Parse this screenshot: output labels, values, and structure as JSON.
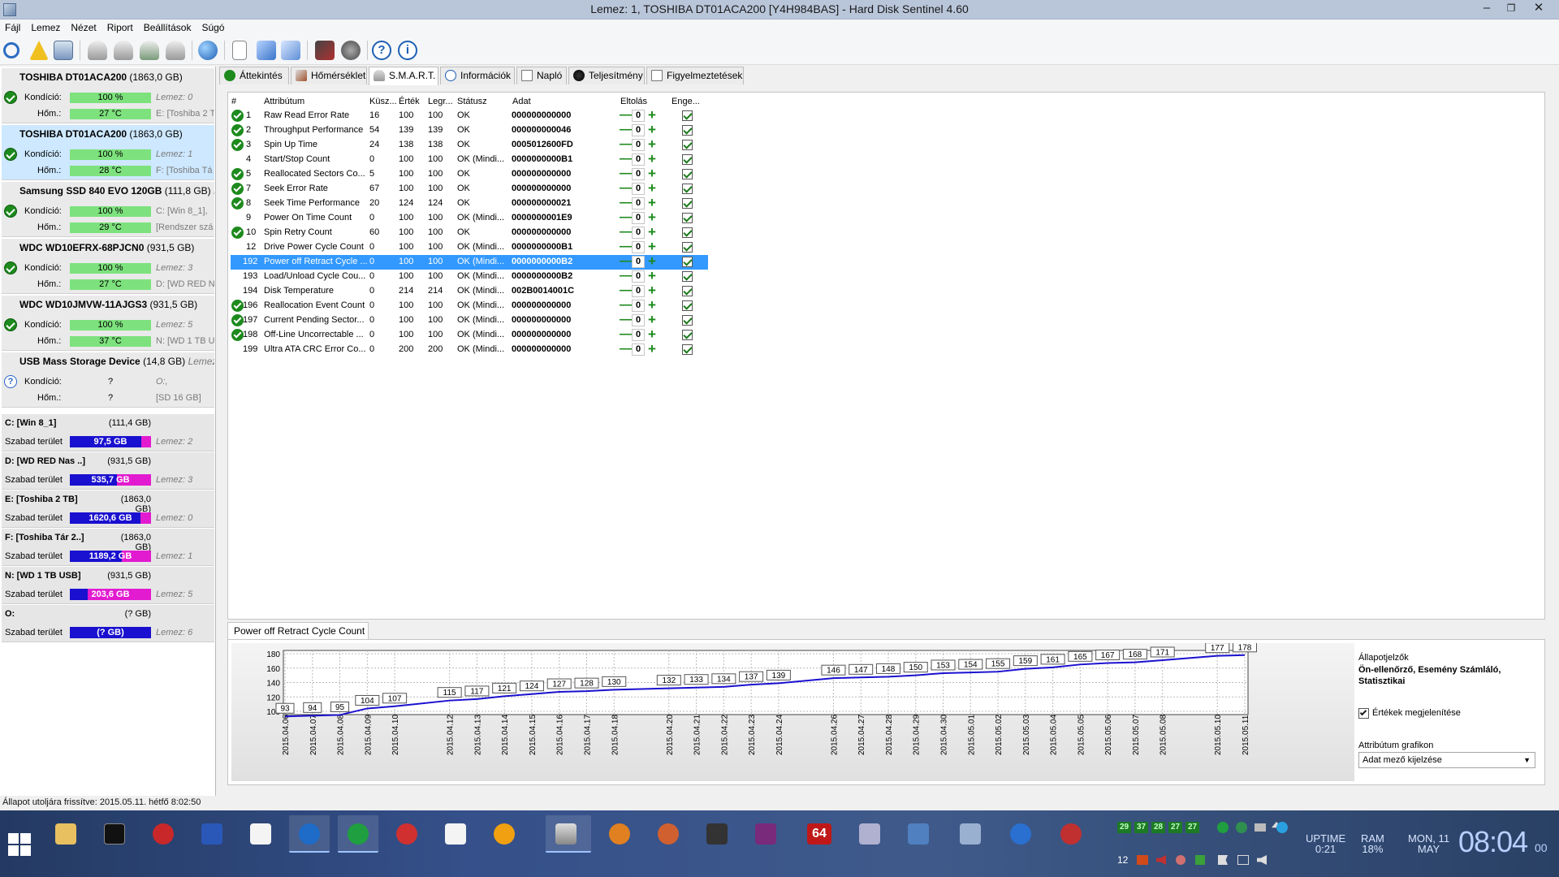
{
  "window": {
    "title": "Lemez: 1, TOSHIBA DT01ACA200 [Y4H984BAS]  -  Hard Disk Sentinel 4.60"
  },
  "menu": [
    "Fájl",
    "Lemez",
    "Nézet",
    "Riport",
    "Beállítások",
    "Súgó"
  ],
  "disks": [
    {
      "name": "TOSHIBA DT01ACA200",
      "size": "(1863,0 GB)",
      "cond_label": "Kondíció:",
      "cond": "100 %",
      "disk_ref": "Lemez: 0",
      "temp_label": "Hőm.:",
      "temp": "27 °C",
      "vol": "E: [Toshiba 2 T"
    },
    {
      "name": "TOSHIBA DT01ACA200",
      "size": "(1863,0 GB)",
      "cond_label": "Kondíció:",
      "cond": "100 %",
      "disk_ref": "Lemez: 1",
      "temp_label": "Hőm.:",
      "temp": "28 °C",
      "vol": "F: [Toshiba Tá"
    },
    {
      "name": "Samsung SSD 840 EVO 120GB",
      "size": "(111,8 GB)",
      "extra": "Le",
      "cond_label": "Kondíció:",
      "cond": "100 %",
      "disk_ref": "C: [Win 8_1],",
      "temp_label": "Hőm.:",
      "temp": "29 °C",
      "vol": "[Rendszer szá"
    },
    {
      "name": "WDC WD10EFRX-68PJCN0",
      "size": "(931,5 GB)",
      "cond_label": "Kondíció:",
      "cond": "100 %",
      "disk_ref": "Lemez: 3",
      "temp_label": "Hőm.:",
      "temp": "27 °C",
      "vol": "D: [WD RED N"
    },
    {
      "name": "WDC WD10JMVW-11AJGS3",
      "size": "(931,5 GB)",
      "cond_label": "Kondíció:",
      "cond": "100 %",
      "disk_ref": "Lemez: 5",
      "temp_label": "Hőm.:",
      "temp": "37 °C",
      "vol": "N: [WD 1 TB U"
    },
    {
      "name": "USB Mass Storage Device",
      "size": "(14,8 GB)",
      "extra": "Lemez:",
      "cond_label": "Kondíció:",
      "cond": "?",
      "disk_ref": "O:,",
      "temp_label": "Hőm.:",
      "temp": "?",
      "vol": "[SD 16 GB]"
    }
  ],
  "partitions": [
    {
      "name": "C: [Win 8_1]",
      "size": "(111,4 GB)",
      "free_label": "Szabad terület",
      "free": "97,5 GB",
      "free_ratio": 0.88,
      "disk_ref": "Lemez: 2"
    },
    {
      "name": "D: [WD RED Nas ..]",
      "size": "(931,5 GB)",
      "free_label": "Szabad terület",
      "free": "535,7 GB",
      "free_ratio": 0.58,
      "disk_ref": "Lemez: 3"
    },
    {
      "name": "E: [Toshiba 2 TB]",
      "size": "(1863,0 GB)",
      "free_label": "Szabad terület",
      "free": "1620,6 GB",
      "free_ratio": 0.87,
      "disk_ref": "Lemez: 0"
    },
    {
      "name": "F: [Toshiba Tár 2..]",
      "size": "(1863,0 GB)",
      "free_label": "Szabad terület",
      "free": "1189,2 GB",
      "free_ratio": 0.64,
      "disk_ref": "Lemez: 1"
    },
    {
      "name": "N: [WD 1 TB USB]",
      "size": "(931,5 GB)",
      "free_label": "Szabad terület",
      "free": "203,6 GB",
      "free_ratio": 0.22,
      "disk_ref": "Lemez: 5"
    },
    {
      "name": "O:",
      "size": "(? GB)",
      "free_label": "Szabad terület",
      "free": "(? GB)",
      "free_ratio": 1.0,
      "disk_ref": "Lemez: 6"
    }
  ],
  "tabs": [
    "Áttekintés",
    "Hőmérséklet",
    "S.M.A.R.T.",
    "Információk",
    "Napló",
    "Teljesítmény",
    "Figyelmeztetések"
  ],
  "smart": {
    "headers": {
      "num": "#",
      "attr": "Attribútum",
      "thr": "Küsz...",
      "val": "Érték",
      "worst": "Legr...",
      "status": "Státusz",
      "data": "Adat",
      "offset": "Eltolás",
      "enable": "Enge..."
    },
    "rows": [
      {
        "ok": true,
        "num": "1",
        "attr": "Raw Read Error Rate",
        "thr": "16",
        "val": "100",
        "worst": "100",
        "status": "OK",
        "data": "000000000000"
      },
      {
        "ok": true,
        "num": "2",
        "attr": "Throughput Performance",
        "thr": "54",
        "val": "139",
        "worst": "139",
        "status": "OK",
        "data": "000000000046"
      },
      {
        "ok": true,
        "num": "3",
        "attr": "Spin Up Time",
        "thr": "24",
        "val": "138",
        "worst": "138",
        "status": "OK",
        "data": "0005012600FD"
      },
      {
        "ok": false,
        "num": "4",
        "attr": "Start/Stop Count",
        "thr": "0",
        "val": "100",
        "worst": "100",
        "status": "OK (Mindi...",
        "data": "0000000000B1"
      },
      {
        "ok": true,
        "num": "5",
        "attr": "Reallocated Sectors Co...",
        "thr": "5",
        "val": "100",
        "worst": "100",
        "status": "OK",
        "data": "000000000000"
      },
      {
        "ok": true,
        "num": "7",
        "attr": "Seek Error Rate",
        "thr": "67",
        "val": "100",
        "worst": "100",
        "status": "OK",
        "data": "000000000000"
      },
      {
        "ok": true,
        "num": "8",
        "attr": "Seek Time Performance",
        "thr": "20",
        "val": "124",
        "worst": "124",
        "status": "OK",
        "data": "000000000021"
      },
      {
        "ok": false,
        "num": "9",
        "attr": "Power On Time Count",
        "thr": "0",
        "val": "100",
        "worst": "100",
        "status": "OK (Mindi...",
        "data": "0000000001E9"
      },
      {
        "ok": true,
        "num": "10",
        "attr": "Spin Retry Count",
        "thr": "60",
        "val": "100",
        "worst": "100",
        "status": "OK",
        "data": "000000000000"
      },
      {
        "ok": false,
        "num": "12",
        "attr": "Drive Power Cycle Count",
        "thr": "0",
        "val": "100",
        "worst": "100",
        "status": "OK (Mindi...",
        "data": "0000000000B1"
      },
      {
        "ok": false,
        "num": "192",
        "attr": "Power off Retract Cycle ...",
        "thr": "0",
        "val": "100",
        "worst": "100",
        "status": "OK (Mindi...",
        "data": "0000000000B2",
        "selected": true
      },
      {
        "ok": false,
        "num": "193",
        "attr": "Load/Unload Cycle Cou...",
        "thr": "0",
        "val": "100",
        "worst": "100",
        "status": "OK (Mindi...",
        "data": "0000000000B2"
      },
      {
        "ok": false,
        "num": "194",
        "attr": "Disk Temperature",
        "thr": "0",
        "val": "214",
        "worst": "214",
        "status": "OK (Mindi...",
        "data": "002B0014001C"
      },
      {
        "ok": true,
        "num": "196",
        "attr": "Reallocation Event Count",
        "thr": "0",
        "val": "100",
        "worst": "100",
        "status": "OK (Mindi...",
        "data": "000000000000"
      },
      {
        "ok": true,
        "num": "197",
        "attr": "Current Pending Sector...",
        "thr": "0",
        "val": "100",
        "worst": "100",
        "status": "OK (Mindi...",
        "data": "000000000000"
      },
      {
        "ok": true,
        "num": "198",
        "attr": "Off-Line Uncorrectable ...",
        "thr": "0",
        "val": "100",
        "worst": "100",
        "status": "OK (Mindi...",
        "data": "000000000000"
      },
      {
        "ok": false,
        "num": "199",
        "attr": "Ultra ATA CRC Error Co...",
        "thr": "0",
        "val": "200",
        "worst": "200",
        "status": "OK (Mindi...",
        "data": "000000000000"
      }
    ],
    "offset_value": "0"
  },
  "graph": {
    "tab_label": "Power off Retract Cycle Count",
    "side_title": "Állapotjelzők",
    "side_subtitle": "Ön-ellenőrző, Esemény Számláló, Statisztikai",
    "show_values_label": "Értékek megjelenítése",
    "attr_graph_label": "Attribútum grafikon",
    "select_value": "Adat mező kijelzése"
  },
  "chart_data": {
    "type": "line",
    "ylim": [
      100,
      180
    ],
    "yticks": [
      100,
      120,
      140,
      160,
      180
    ],
    "x": [
      "2015.04.06",
      "2015.04.07",
      "2015.04.08",
      "2015.04.09",
      "2015.04.10",
      "2015.04.12",
      "2015.04.13",
      "2015.04.14",
      "2015.04.15",
      "2015.04.16",
      "2015.04.17",
      "2015.04.18",
      "2015.04.20",
      "2015.04.21",
      "2015.04.22",
      "2015.04.23",
      "2015.04.24",
      "2015.04.26",
      "2015.04.27",
      "2015.04.28",
      "2015.04.29",
      "2015.04.30",
      "2015.05.01",
      "2015.05.02",
      "2015.05.03",
      "2015.05.04",
      "2015.05.05",
      "2015.05.06",
      "2015.05.07",
      "2015.05.08",
      "2015.05.10",
      "2015.05.11"
    ],
    "values": [
      93,
      94,
      95,
      104,
      107,
      115,
      117,
      121,
      124,
      127,
      128,
      130,
      132,
      133,
      134,
      137,
      139,
      146,
      147,
      148,
      150,
      153,
      154,
      155,
      159,
      161,
      165,
      167,
      168,
      171,
      177,
      178
    ]
  },
  "statusbar": "Állapot utoljára frissítve: 2015.05.11. hétfő 8:02:50",
  "tray": {
    "temps": [
      "29",
      "37",
      "28",
      "27",
      "27"
    ],
    "uptime_label": "UPTIME",
    "uptime": "0:21",
    "ram_label": "RAM",
    "ram": "18%",
    "day": "MON, 11",
    "month": "MAY",
    "time": "08:04",
    "seconds": "00",
    "lang": "12"
  },
  "colors": {
    "accent": "#3399ff",
    "ok": "#1d8a1d",
    "free_bar": "#e21bd0",
    "used_bar": "#1a10cf",
    "line": "#1a10cf"
  }
}
